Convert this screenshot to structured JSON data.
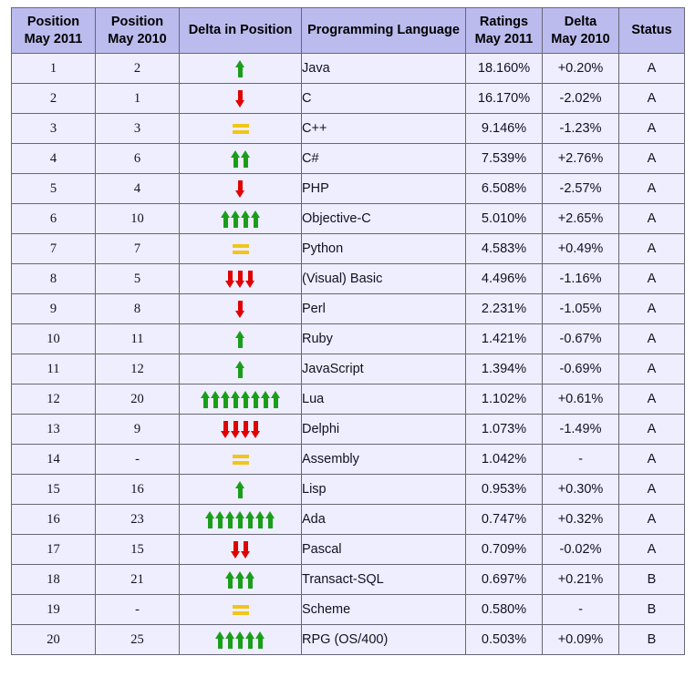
{
  "table": {
    "columns": [
      {
        "line1": "Position",
        "line2": "May 2011",
        "key": "pos_2011"
      },
      {
        "line1": "Position",
        "line2": "May 2010",
        "key": "pos_2010"
      },
      {
        "line1": "Delta in Position",
        "line2": "",
        "key": "delta_pos"
      },
      {
        "line1": "Programming Language",
        "line2": "",
        "key": "language"
      },
      {
        "line1": "Ratings",
        "line2": "May 2011",
        "key": "ratings_2011"
      },
      {
        "line1": "Delta",
        "line2": "May 2010",
        "key": "delta_2010"
      },
      {
        "line1": "Status",
        "line2": "",
        "key": "status"
      }
    ],
    "rows": [
      {
        "pos_2011": "1",
        "pos_2010": "2",
        "delta_dir": "up",
        "delta_count": 1,
        "language": "Java",
        "ratings_2011": "18.160%",
        "delta_2010": "+0.20%",
        "status": "A"
      },
      {
        "pos_2011": "2",
        "pos_2010": "1",
        "delta_dir": "down",
        "delta_count": 1,
        "language": "C",
        "ratings_2011": "16.170%",
        "delta_2010": "-2.02%",
        "status": "A"
      },
      {
        "pos_2011": "3",
        "pos_2010": "3",
        "delta_dir": "same",
        "delta_count": 0,
        "language": "C++",
        "ratings_2011": "9.146%",
        "delta_2010": "-1.23%",
        "status": "A"
      },
      {
        "pos_2011": "4",
        "pos_2010": "6",
        "delta_dir": "up",
        "delta_count": 2,
        "language": "C#",
        "ratings_2011": "7.539%",
        "delta_2010": "+2.76%",
        "status": "A"
      },
      {
        "pos_2011": "5",
        "pos_2010": "4",
        "delta_dir": "down",
        "delta_count": 1,
        "language": "PHP",
        "ratings_2011": "6.508%",
        "delta_2010": "-2.57%",
        "status": "A"
      },
      {
        "pos_2011": "6",
        "pos_2010": "10",
        "delta_dir": "up",
        "delta_count": 4,
        "language": "Objective-C",
        "ratings_2011": "5.010%",
        "delta_2010": "+2.65%",
        "status": "A"
      },
      {
        "pos_2011": "7",
        "pos_2010": "7",
        "delta_dir": "same",
        "delta_count": 0,
        "language": "Python",
        "ratings_2011": "4.583%",
        "delta_2010": "+0.49%",
        "status": "A"
      },
      {
        "pos_2011": "8",
        "pos_2010": "5",
        "delta_dir": "down",
        "delta_count": 3,
        "language": "(Visual) Basic",
        "ratings_2011": "4.496%",
        "delta_2010": "-1.16%",
        "status": "A"
      },
      {
        "pos_2011": "9",
        "pos_2010": "8",
        "delta_dir": "down",
        "delta_count": 1,
        "language": "Perl",
        "ratings_2011": "2.231%",
        "delta_2010": "-1.05%",
        "status": "A"
      },
      {
        "pos_2011": "10",
        "pos_2010": "11",
        "delta_dir": "up",
        "delta_count": 1,
        "language": "Ruby",
        "ratings_2011": "1.421%",
        "delta_2010": "-0.67%",
        "status": "A"
      },
      {
        "pos_2011": "11",
        "pos_2010": "12",
        "delta_dir": "up",
        "delta_count": 1,
        "language": "JavaScript",
        "ratings_2011": "1.394%",
        "delta_2010": "-0.69%",
        "status": "A"
      },
      {
        "pos_2011": "12",
        "pos_2010": "20",
        "delta_dir": "up",
        "delta_count": 8,
        "language": "Lua",
        "ratings_2011": "1.102%",
        "delta_2010": "+0.61%",
        "status": "A"
      },
      {
        "pos_2011": "13",
        "pos_2010": "9",
        "delta_dir": "down",
        "delta_count": 4,
        "language": "Delphi",
        "ratings_2011": "1.073%",
        "delta_2010": "-1.49%",
        "status": "A"
      },
      {
        "pos_2011": "14",
        "pos_2010": "-",
        "delta_dir": "same",
        "delta_count": 0,
        "language": "Assembly",
        "ratings_2011": "1.042%",
        "delta_2010": "-",
        "status": "A"
      },
      {
        "pos_2011": "15",
        "pos_2010": "16",
        "delta_dir": "up",
        "delta_count": 1,
        "language": "Lisp",
        "ratings_2011": "0.953%",
        "delta_2010": "+0.30%",
        "status": "A"
      },
      {
        "pos_2011": "16",
        "pos_2010": "23",
        "delta_dir": "up",
        "delta_count": 7,
        "language": "Ada",
        "ratings_2011": "0.747%",
        "delta_2010": "+0.32%",
        "status": "A"
      },
      {
        "pos_2011": "17",
        "pos_2010": "15",
        "delta_dir": "down",
        "delta_count": 2,
        "language": "Pascal",
        "ratings_2011": "0.709%",
        "delta_2010": "-0.02%",
        "status": "A"
      },
      {
        "pos_2011": "18",
        "pos_2010": "21",
        "delta_dir": "up",
        "delta_count": 3,
        "language": "Transact-SQL",
        "ratings_2011": "0.697%",
        "delta_2010": "+0.21%",
        "status": "B"
      },
      {
        "pos_2011": "19",
        "pos_2010": "-",
        "delta_dir": "same",
        "delta_count": 0,
        "language": "Scheme",
        "ratings_2011": "0.580%",
        "delta_2010": "-",
        "status": "B"
      },
      {
        "pos_2011": "20",
        "pos_2010": "25",
        "delta_dir": "up",
        "delta_count": 5,
        "language": "RPG (OS/400)",
        "ratings_2011": "0.503%",
        "delta_2010": "+0.09%",
        "status": "B"
      }
    ]
  },
  "colors": {
    "header_bg": "#bbbbee",
    "cell_bg": "#eeeeff",
    "border": "#666677",
    "arrow_up": "#1a9e1a",
    "arrow_down": "#e00000",
    "equals": "#f2c518",
    "language_text": "#222288"
  },
  "icons": {
    "arrow_up": "arrow-up-icon",
    "arrow_down": "arrow-down-icon",
    "equals": "equals-icon"
  }
}
